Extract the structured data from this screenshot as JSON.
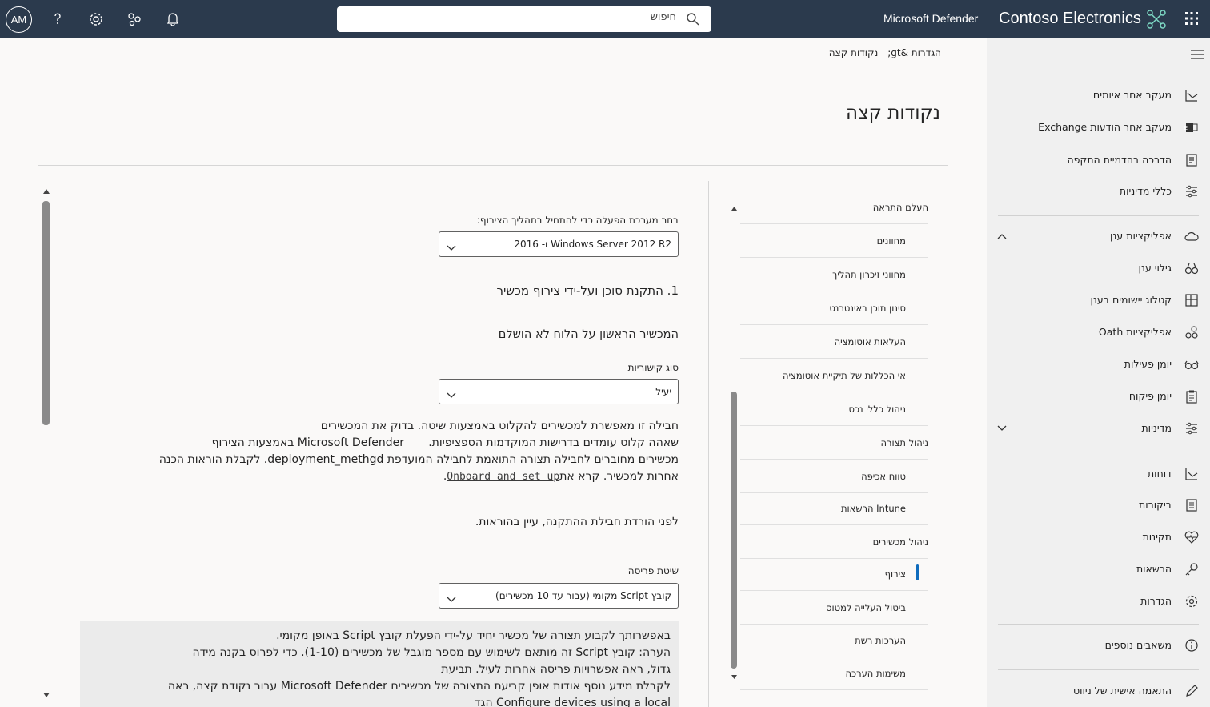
{
  "topbar": {
    "avatar_initials": "AM",
    "search_placeholder": "חיפוש",
    "product_name": "Microsoft Defender",
    "org_name": "Contoso Electronics",
    "icons": [
      "help-icon",
      "settings-icon",
      "share-icon",
      "bell-icon",
      "waffle-icon"
    ]
  },
  "nav": {
    "items": [
      {
        "label": "מעקב אחר איומים",
        "icon": "chart-icon"
      },
      {
        "label": "מעקב אחר הודעות Exchange",
        "icon": "exchange-icon"
      },
      {
        "label": "הדרכה בהדמיית התקפה",
        "icon": "training-icon"
      },
      {
        "label": "כללי מדיניות",
        "icon": "sliders-icon"
      },
      {
        "label": "אפליקציות ענן",
        "icon": "cloud-icon"
      },
      {
        "label": "גילוי ענן",
        "icon": "binoculars-icon"
      },
      {
        "label": "קטלוג יישומים בענן",
        "icon": "grid-icon"
      },
      {
        "label": "אפליקציות Oath",
        "icon": "apps-icon"
      },
      {
        "label": "יומן פעילות",
        "icon": "glasses-icon"
      },
      {
        "label": "יומן פיקוח",
        "icon": "clipboard-icon"
      },
      {
        "label": "מדיניות",
        "icon": "sliders-icon"
      },
      {
        "label": "דוחות",
        "icon": "chart-icon"
      },
      {
        "label": "ביקורות",
        "icon": "audit-icon"
      },
      {
        "label": "תקינות",
        "icon": "heart-icon"
      },
      {
        "label": "הרשאות",
        "icon": "key-icon"
      },
      {
        "label": "הגדרות",
        "icon": "gear-icon"
      },
      {
        "label": "משאבים נוספים",
        "icon": "info-icon"
      },
      {
        "label": "התאמה אישית של ניווט",
        "icon": "pencil-icon"
      }
    ]
  },
  "breadcrumb": {
    "part1": "הגדרות &gt;",
    "part2": "נקודות קצה"
  },
  "page_title": "נקודות קצה",
  "subnav": {
    "items": [
      "העלם התראה",
      "מחוונים",
      "מחווני זיכרון תהליך",
      "סינון תוכן באינטרנט",
      "העלאות אוטומציה",
      "אי הכללות של תיקיית אוטומציה",
      "ניהול כללי נכס",
      "ניהול תצורה",
      "טווח אכיפה",
      "Intune הרשאות",
      "ניהול מכשירים",
      "צירוף",
      "ביטול העלייה למטוס",
      "הערכות רשת",
      "משימות הערכה"
    ],
    "selected": "צירוף"
  },
  "content": {
    "os_label": "בחר מערכת הפעלה כדי להתחיל בתהליך הצירוף:",
    "os_value": "Windows Server 2012 R2 ו- 2016",
    "step_title": "1. התקנת סוכן ועל-ידי צירוף מכשיר",
    "first_device": "המכשיר הראשון על הלוח לא הושלם",
    "connectivity_label": "סוג קישוריות",
    "connectivity_value": "יעיל",
    "para_line1": "חבילה זו מאפשרת למכשירים להקלוט באמצעות שיטה. בדוק את המכשירים",
    "para_line2": "שאהה קלוט עומדים בדרישות המוקדמות הספציפיות.",
    "para_line2b": "Microsoft Defender באמצעות הצירוף",
    "para_line3": "מכשירים מחוברים לחבילה תצורה התואמת לחבילה המועדפת deployment_methgd. לקבלת הוראות הכנה",
    "para_line4": "אחרות למכשיר. קרא את",
    "para_link": "Onboard and set up",
    "read_before": "לפני הורדת חבילת ההתקנה, עיין בהוראות.",
    "deploy_label": "שיטת פריסה",
    "deploy_value": "קובץ Script מקומי (עבור עד 10 מכשירים)",
    "note_line1": "באפשרותך לקבוע תצורה של מכשיר יחיד על-ידי הפעלת קובץ Script באופן מקומי.",
    "note_line2": "הערה: קובץ Script זה מותאם לשימוש עם מספר מוגבל של מכשירים (1-10). כדי לפרוס בקנה מידה",
    "note_line3": "גדול, ראה אפשרויות פריסה אחרות לעיל. תביעת",
    "note_line4": "לקבלת מידע נוסף אודות אופן קביעת התצורה של מכשירים Microsoft Defender עבור נקודת קצה, ראה",
    "note_line5": "Configure devices using a local הגד"
  }
}
